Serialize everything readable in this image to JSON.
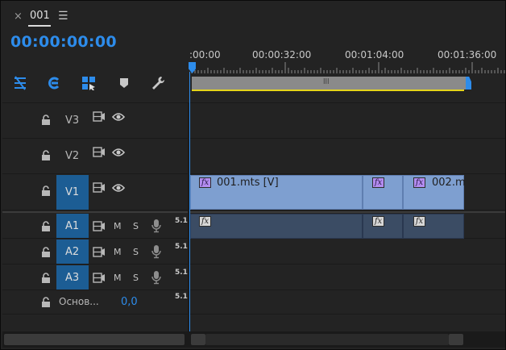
{
  "panel": {
    "close_glyph": "×",
    "title": "001",
    "menu_glyph": "☰",
    "timecode": "00:00:00:00"
  },
  "toolbar": {
    "items": [
      {
        "name": "snap-icon"
      },
      {
        "name": "linked-selection-icon"
      },
      {
        "name": "add-marker-icon"
      },
      {
        "name": "marker-icon"
      },
      {
        "name": "wrench-icon"
      }
    ]
  },
  "ruler": {
    "labels": [
      ":00:00",
      "00:00:32:00",
      "00:01:04:00",
      "00:01:36:00"
    ]
  },
  "workarea": {
    "grip": "lll"
  },
  "video_tracks": [
    {
      "id": "v3",
      "label": "V3",
      "targeted": false
    },
    {
      "id": "v2",
      "label": "V2",
      "targeted": false
    },
    {
      "id": "v1",
      "label": "V1",
      "targeted": true
    }
  ],
  "audio_tracks": [
    {
      "id": "a1",
      "label": "A1",
      "mute": "M",
      "solo": "S",
      "level": "5.1"
    },
    {
      "id": "a2",
      "label": "A2",
      "mute": "M",
      "solo": "S",
      "level": "5.1"
    },
    {
      "id": "a3",
      "label": "A3",
      "mute": "M",
      "solo": "S",
      "level": "5.1"
    }
  ],
  "master": {
    "label": "Основ...",
    "value": "0,0",
    "level": "5.1"
  },
  "clips": {
    "v1_first": {
      "name": "001.mts [V]",
      "fx": "fx"
    },
    "v1_second": {
      "fx": "fx"
    },
    "v1_third": {
      "name": "002.m",
      "fx": "fx"
    },
    "a1_fx": "fx"
  },
  "colors": {
    "accent": "#2d8ceb",
    "video_clip": "#7e9fd0",
    "audio_clip": "#3b4c64",
    "track_target": "#1c5d94",
    "workarea_line": "#e5d41b"
  }
}
